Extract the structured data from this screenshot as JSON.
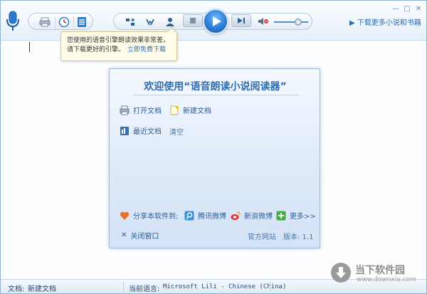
{
  "toolbar": {
    "download_more": "下载更多小说和书籍",
    "left_group_icons": [
      "print-icon",
      "clock-icon",
      "list-icon"
    ],
    "middle_group_icons": [
      "shuffle-icon",
      "repeat-icon",
      "user-icon"
    ],
    "volume_level": 0.7,
    "window_controls": [
      "—",
      "□",
      "✕"
    ]
  },
  "tooltip": {
    "line1": "您使用的语音引擎朗读效果非常差，",
    "line2": "请下载更好的引擎。",
    "link": "立即免费下载"
  },
  "dialog": {
    "title": "欢迎使用“语音朗读小说阅读器”",
    "open_doc": "打开文档",
    "new_doc": "新建文档",
    "recent_docs": "最近文档",
    "clear": "清空",
    "share_label": "分享本软件到:",
    "tencent_weibo": "腾讯微博",
    "sina_weibo": "新浪微博",
    "more": "更多>>",
    "close_window": "关闭窗口",
    "official_site": "官方网站",
    "version": "版本: 1.1"
  },
  "statusbar": {
    "doc_label": "文档:",
    "doc_name": "新建文档",
    "lang_label": "当前语言:",
    "lang_value": "Microsoft Lili - Chinese (China)"
  },
  "watermark": {
    "name": "当下软件园",
    "url": "www.downxia.com"
  },
  "colors": {
    "accent": "#2f6cb2",
    "link": "#2b6cb8",
    "tooltip_bg": "#fffde9"
  }
}
